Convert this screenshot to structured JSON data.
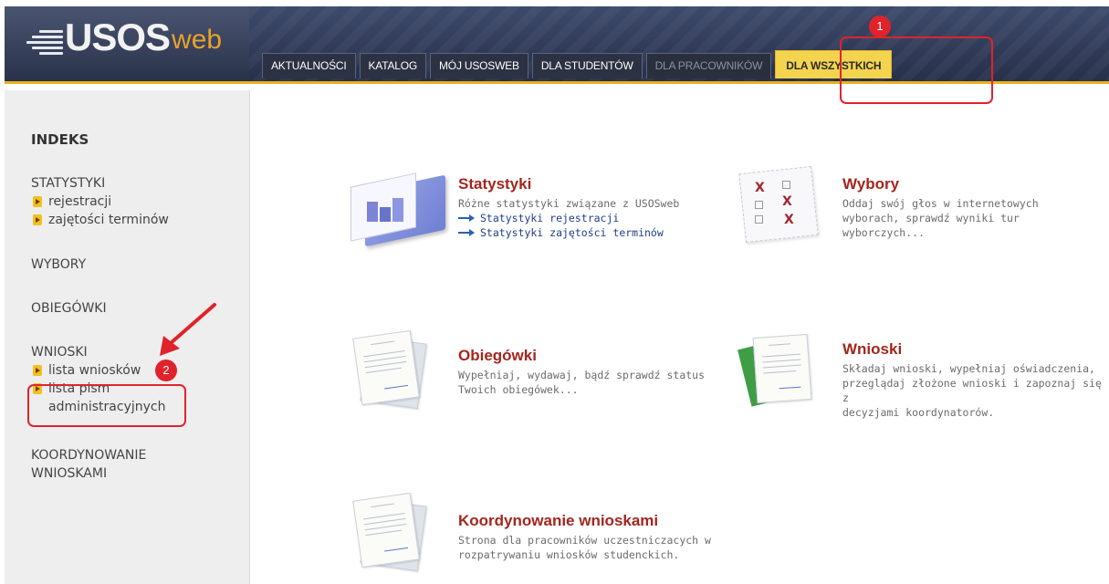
{
  "logo": {
    "main": "USOS",
    "accent": "web"
  },
  "nav": {
    "tabs": [
      {
        "label": "AKTUALNOŚCI"
      },
      {
        "label": "KATALOG"
      },
      {
        "label": "MÓJ USOSWEB"
      },
      {
        "label": "DLA STUDENTÓW"
      },
      {
        "label": "DLA PRACOWNIKÓW"
      },
      {
        "label": "DLA WSZYSTKICH"
      }
    ],
    "active_tab": "DLA WSZYSTKICH"
  },
  "sidebar": {
    "title": "INDEKS",
    "sections": [
      {
        "label": "STATYSTYKI",
        "items": [
          "rejestracji",
          "zajętości terminów"
        ]
      },
      {
        "label": "WYBORY"
      },
      {
        "label": "OBIEGÓWKI"
      },
      {
        "label": "WNIOSKI",
        "items": [
          "lista wniosków",
          "lista pism",
          "administracyjnych"
        ]
      },
      {
        "label": "KOORDYNOWANIE",
        "label2": "WNIOSKAMI"
      }
    ]
  },
  "cards": {
    "statystyki": {
      "title": "Statystyki",
      "desc": "Różne statystyki związane z USOSweb",
      "links": [
        "Statystyki rejestracji",
        "Statystyki zajętości terminów"
      ]
    },
    "wybory": {
      "title": "Wybory",
      "desc": [
        "Oddaj swój głos w internetowych",
        "wyborach, sprawdź wyniki tur",
        "wyborczych..."
      ]
    },
    "obiegowki": {
      "title": "Obiegówki",
      "desc": [
        "Wypełniaj, wydawaj, bądź sprawdź status",
        "Twoich obiegówek..."
      ]
    },
    "wnioski": {
      "title": "Wnioski",
      "desc": [
        "Składaj wnioski, wypełniaj oświadczenia,",
        "przeglądaj złożone wnioski i zapoznaj się z",
        "decyzjami koordynatorów."
      ]
    },
    "koordynowanie": {
      "title": "Koordynowanie wnioskami",
      "desc": [
        "Strona dla pracowników uczestniczacych w",
        "rozpatrywaniu wniosków studenckich."
      ]
    }
  },
  "annotations": {
    "one": "1",
    "two": "2"
  },
  "colors": {
    "accent_yellow": "#f4d44f",
    "title_red": "#a3261e",
    "annotation_red": "#e0232a",
    "header_navy": "#2c3243"
  }
}
